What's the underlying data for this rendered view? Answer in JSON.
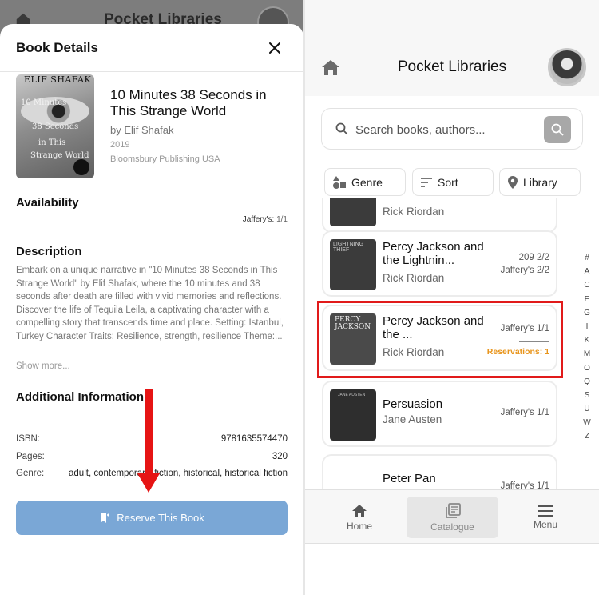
{
  "background_screen": {
    "title": "Pocket Libraries"
  },
  "sheet": {
    "title": "Book Details",
    "cover": {
      "author_text": "ELIF SHAFAK",
      "title_lines": [
        "10 Minutes",
        "38 Seconds",
        "in This",
        "Strange World"
      ]
    },
    "book": {
      "title": "10 Minutes 38 Seconds in This Strange World",
      "author": "by Elif Shafak",
      "year": "2019",
      "publisher": "Bloomsbury Publishing USA"
    },
    "availability": {
      "heading": "Availability",
      "library": "Jaffery's:",
      "count": "1/1"
    },
    "description": {
      "heading": "Description",
      "text": "Embark on a unique narrative in \"10 Minutes 38 Seconds in This Strange World\" by Elif Shafak, where the 10 minutes and 38 seconds after death are filled with vivid memories and reflections. Discover the life of Tequila Leila, a captivating character with a compelling story that transcends time and place. Setting: Istanbul, Turkey Character Traits: Resilience, strength, resilience Theme:...",
      "show_more": "Show more..."
    },
    "additional": {
      "heading": "Additional Information",
      "rows": [
        {
          "key": "ISBN:",
          "value": "9781635574470"
        },
        {
          "key": "Pages:",
          "value": "320"
        },
        {
          "key": "Genre:",
          "value": "adult, contemporary, fiction, historical, historical fiction"
        }
      ]
    },
    "reserve_label": "Reserve This Book"
  },
  "catalogue": {
    "app_title": "Pocket Libraries",
    "search": {
      "placeholder": "Search books, authors..."
    },
    "filters": {
      "genre": "Genre",
      "sort": "Sort",
      "library": "Library"
    },
    "books": [
      {
        "title": "",
        "author": "Rick Riordan",
        "status": ""
      },
      {
        "title": "Percy Jackson and the Lightnin...",
        "author": "Rick Riordan",
        "status_lines": [
          "209 2/2",
          "Jaffery's 2/2"
        ]
      },
      {
        "title": "Percy Jackson and the ...",
        "author": "Rick Riordan",
        "status_lines": [
          "Jaffery's 1/1"
        ],
        "reservations": "Reservations: 1"
      },
      {
        "title": "Persuasion",
        "author": "Jane Austen",
        "status_lines": [
          "Jaffery's 1/1"
        ]
      },
      {
        "title": "Peter Pan",
        "author": "",
        "status_lines": [
          "Jaffery's 1/1"
        ]
      }
    ],
    "cover_texts": {
      "lightning": "LIGHTNING THIEF",
      "percy": "PERCY JACKSON",
      "persuasion": "JANE AUSTEN"
    },
    "alphabet": [
      "#",
      "A",
      "C",
      "E",
      "G",
      "I",
      "K",
      "M",
      "O",
      "Q",
      "S",
      "U",
      "W",
      "Z"
    ],
    "tabs": {
      "home": "Home",
      "catalogue": "Catalogue",
      "menu": "Menu"
    }
  },
  "colors": {
    "reserve_button": "#7aa7d6",
    "annotation_red": "#e61414",
    "reservations_orange": "#e8951c"
  }
}
